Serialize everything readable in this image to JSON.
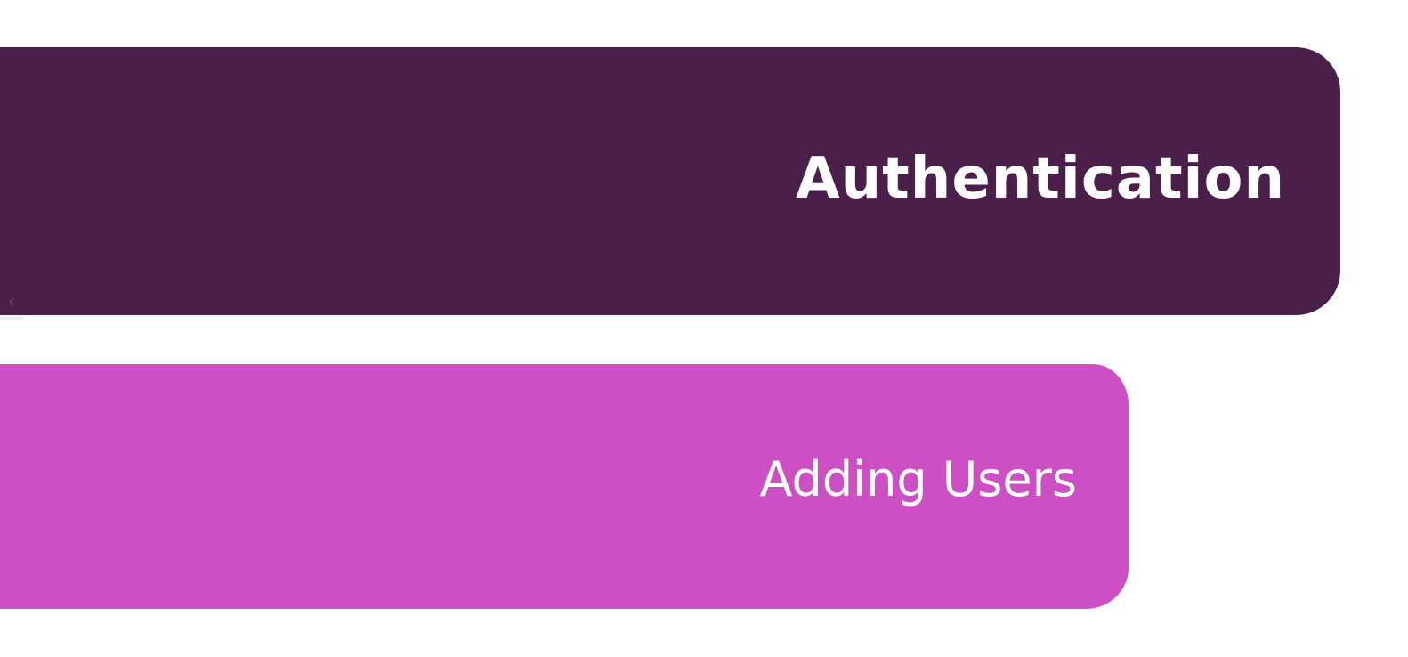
{
  "colors": {
    "primary": "#4a1f4a",
    "secondary": "#cc4fc3"
  },
  "sections": [
    {
      "title": "Authentication"
    },
    {
      "title": "Adding Users"
    }
  ],
  "nav": {
    "back_icon": "chevron-left-icon"
  }
}
